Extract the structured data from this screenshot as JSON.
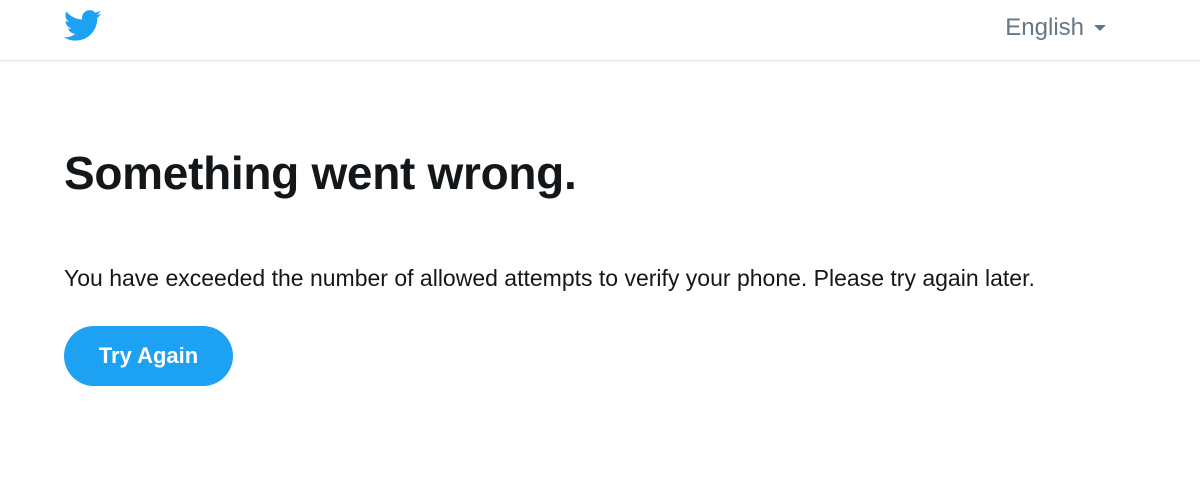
{
  "header": {
    "logo_icon": "twitter-bird-icon",
    "language": {
      "selected": "English",
      "icon": "caret-down-icon"
    }
  },
  "main": {
    "title": "Something went wrong.",
    "message": "You have exceeded the number of allowed attempts to verify your phone. Please try again later.",
    "button_label": "Try Again"
  },
  "colors": {
    "brand": "#1da1f2",
    "text": "#14171a",
    "muted": "#657786",
    "border": "#e1e8ed"
  }
}
